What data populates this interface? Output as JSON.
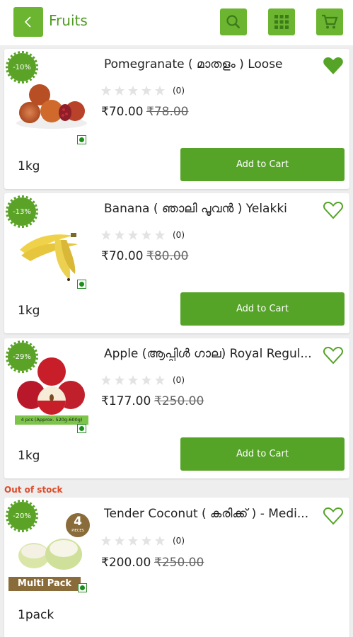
{
  "header": {
    "title": "Fruits",
    "back_icon": "chevron-left-icon",
    "icons": [
      "search-icon",
      "grid-icon",
      "cart-icon"
    ]
  },
  "products": [
    {
      "discount": "-10%",
      "name": "Pomegranate ( മാതളം ) Loose",
      "rating_count": "(0)",
      "rating": 0,
      "price": "₹70.00",
      "mrp": "₹78.00",
      "unit": "1kg",
      "cta": "Add to Cart",
      "favorited": true,
      "image_caption": ""
    },
    {
      "discount": "-13%",
      "name": "Banana ( ഞാലി പൂവൻ ) Yelakki",
      "rating_count": "(0)",
      "rating": 0,
      "price": "₹70.00",
      "mrp": "₹80.00",
      "unit": "1kg",
      "cta": "Add to Cart",
      "favorited": false,
      "image_caption": ""
    },
    {
      "discount": "-29%",
      "name": "Apple (ആപ്പിൾ ഗാല) Royal Regul...",
      "rating_count": "(0)",
      "rating": 0,
      "price": "₹177.00",
      "mrp": "₹250.00",
      "unit": "1kg",
      "cta": "Add to Cart",
      "favorited": false,
      "image_caption": "4 pcs (Approx. 520g-600g)"
    },
    {
      "status": "Out of stock",
      "discount": "-20%",
      "name": "Tender Coconut ( കരിക്ക് ) - Medi...",
      "rating_count": "(0)",
      "rating": 0,
      "price": "₹200.00",
      "mrp": "₹250.00",
      "unit": "1pack",
      "favorited": false,
      "image_badge_number": "4",
      "image_badge_text": "PIECES",
      "image_banner": "Multi Pack"
    }
  ],
  "colors": {
    "accent": "#6bb530",
    "button": "#55a327",
    "out_of_stock": "#e04a2a"
  }
}
